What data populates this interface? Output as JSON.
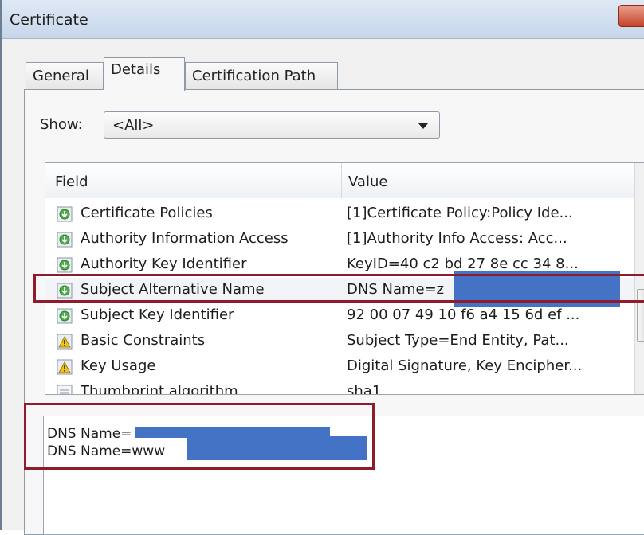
{
  "window": {
    "title": "Certificate"
  },
  "tabs": [
    {
      "label": "General"
    },
    {
      "label": "Details"
    },
    {
      "label": "Certification Path"
    }
  ],
  "show": {
    "label": "Show:",
    "selected": "<All>"
  },
  "list": {
    "headers": {
      "field": "Field",
      "value": "Value"
    },
    "rows": [
      {
        "field": "Certificate Policies",
        "value": "[1]Certificate Policy:Policy Ide...",
        "icon": "extension-icon"
      },
      {
        "field": "Authority Information Access",
        "value": "[1]Authority Info Access: Acc...",
        "icon": "extension-icon"
      },
      {
        "field": "Authority Key Identifier",
        "value": "KeyID=40 c2 bd 27 8e cc 34 8...",
        "icon": "extension-icon"
      },
      {
        "field": "Subject Alternative Name",
        "value": "DNS Name=z",
        "icon": "extension-icon"
      },
      {
        "field": "Subject Key Identifier",
        "value": "92 00 07 49 10 f6 a4 15 6d ef ...",
        "icon": "extension-icon"
      },
      {
        "field": "Basic Constraints",
        "value": "Subject Type=End Entity, Pat...",
        "icon": "critical-extension-icon"
      },
      {
        "field": "Key Usage",
        "value": "Digital Signature, Key Encipher...",
        "icon": "critical-extension-icon"
      },
      {
        "field": "Thumbprint algorithm",
        "value": "sha1",
        "icon": "property-icon"
      }
    ]
  },
  "details": {
    "lines": [
      "DNS Name=",
      "DNS Name=www"
    ]
  },
  "colors": {
    "highlight": "#8e1c2c",
    "redaction": "#4472c4"
  }
}
